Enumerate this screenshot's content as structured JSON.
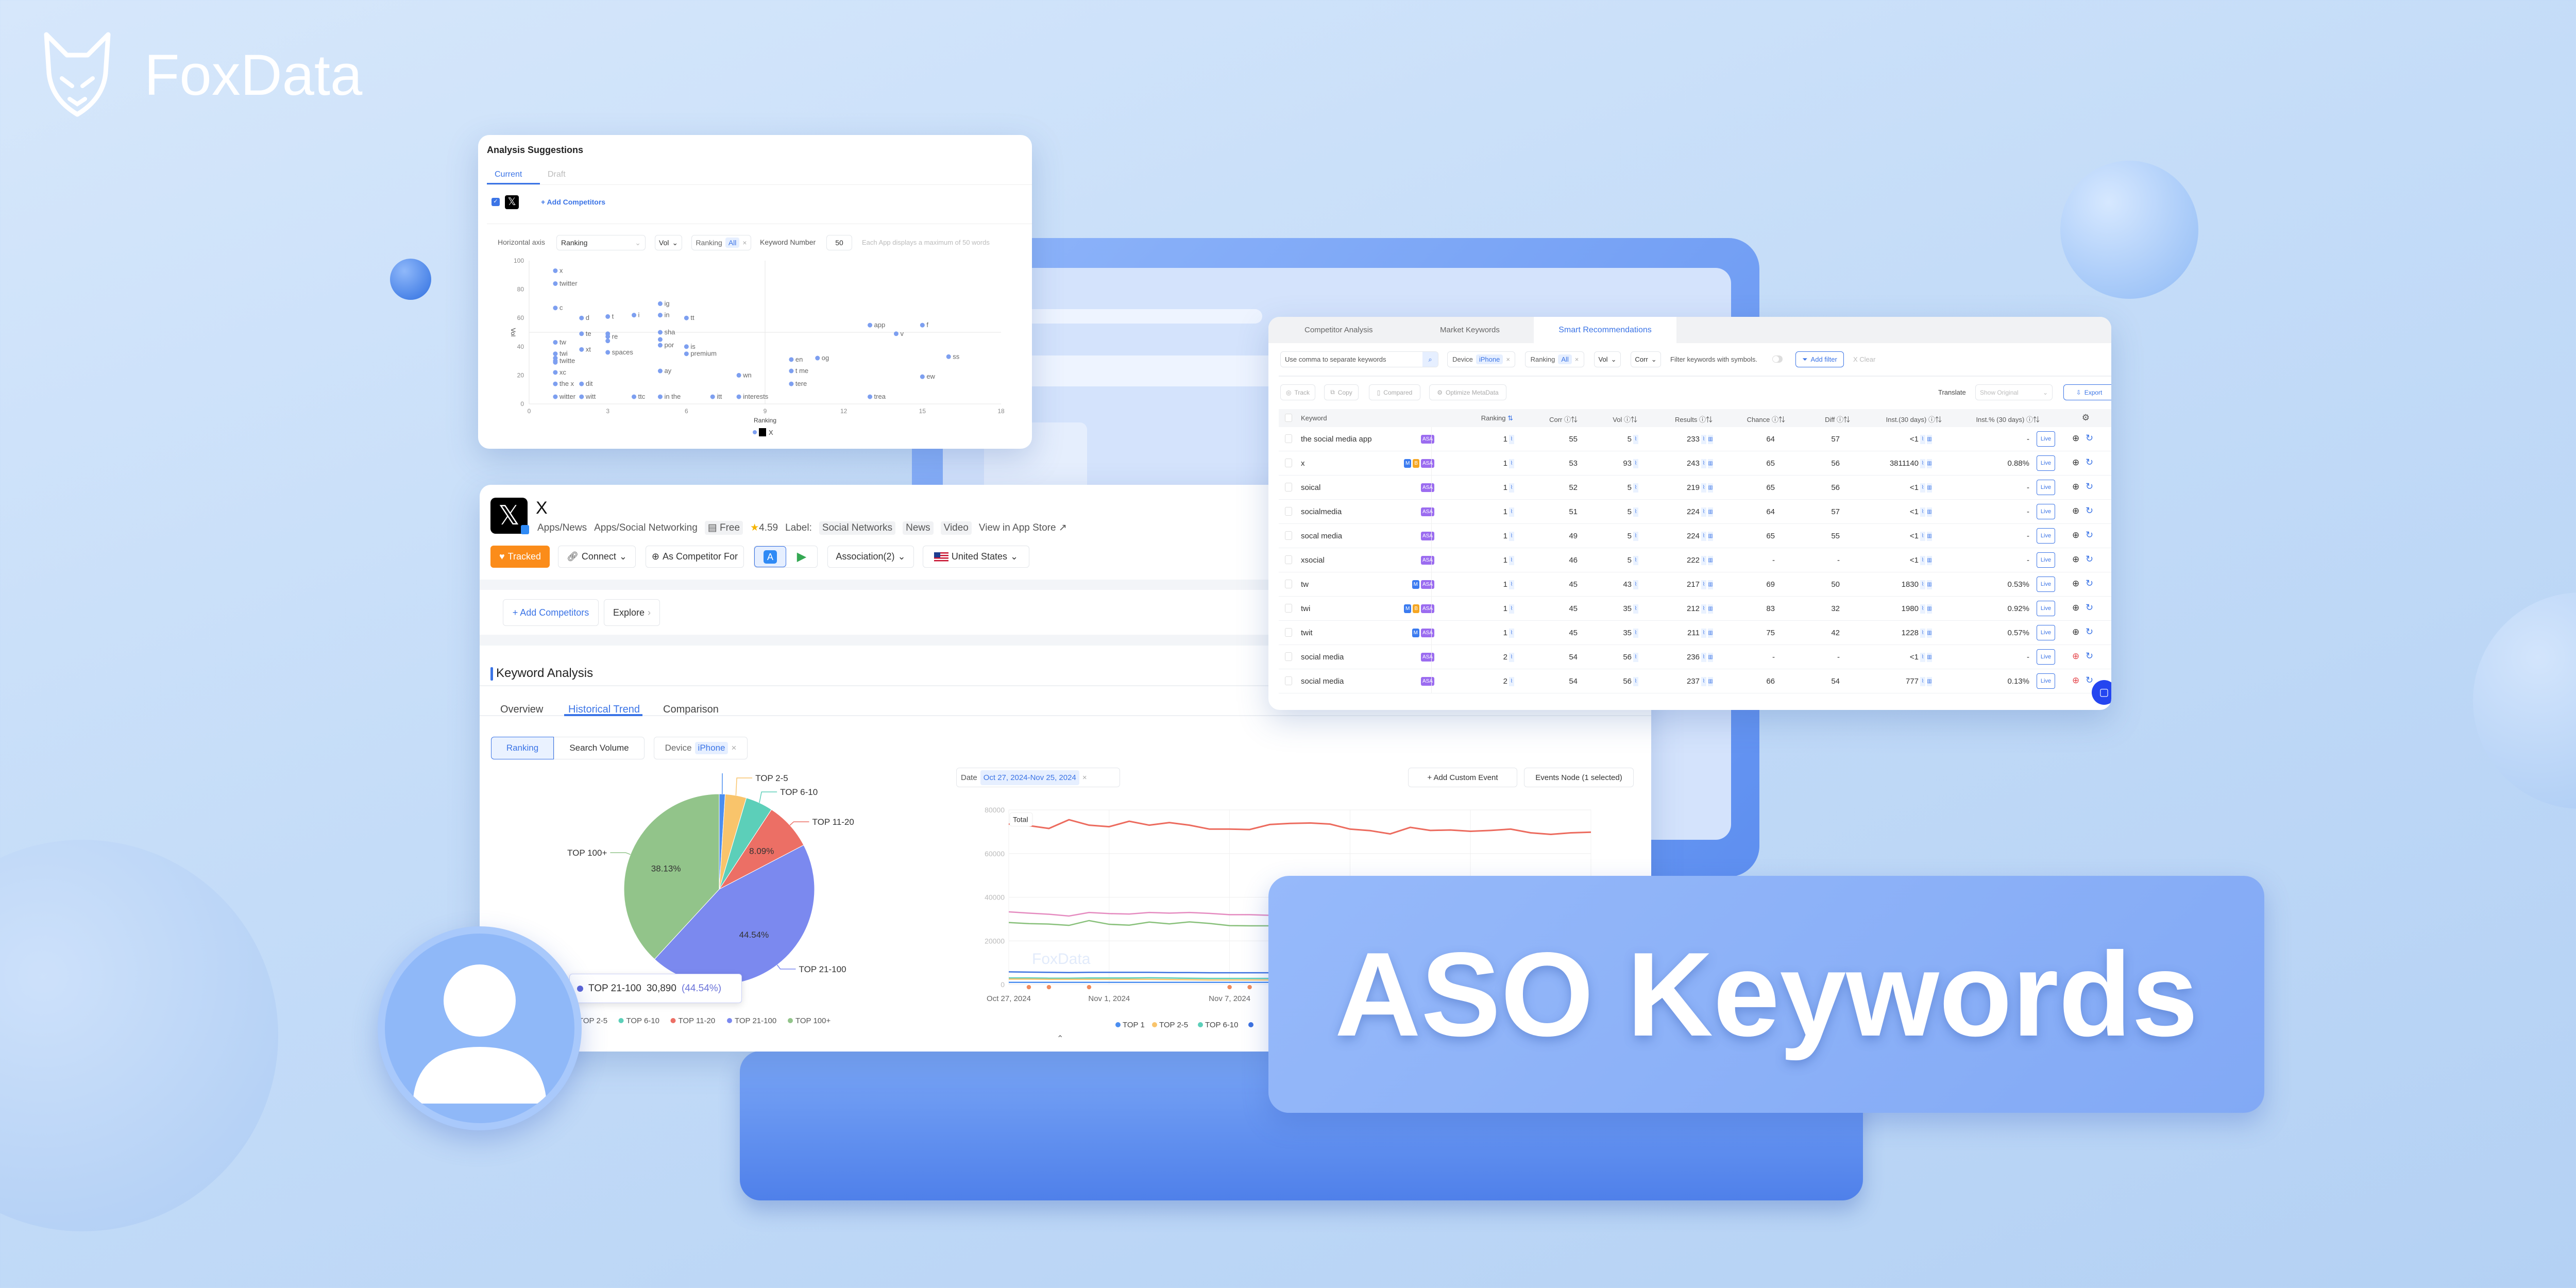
{
  "brand": {
    "name": "FoxData"
  },
  "banner": {
    "title": "ASO Keywords"
  },
  "colors": {
    "accent": "#3b74e6",
    "tracked": "#fb8c1a",
    "asa": "#9b6cf0",
    "badge_m": "#3b7bf0",
    "badge_b": "#f5a623",
    "banner": "#8fb4f8"
  },
  "analysis": {
    "title": "Analysis Suggestions",
    "tabs": [
      "Current",
      "Draft"
    ],
    "add_competitors": "+ Add Competitors",
    "controls": {
      "horizontal_axis_label": "Horizontal axis",
      "horizontal_axis_value": "Ranking",
      "vol": "Vol",
      "ranking_label": "Ranking",
      "ranking_value": "All",
      "keyword_number_label": "Keyword Number",
      "keyword_number_value": "50",
      "note": "Each App displays a maximum of 50 words"
    }
  },
  "app": {
    "icon": "x-app-icon",
    "name": "X",
    "category1": "Apps/News",
    "category2": "Apps/Social Networking",
    "price": "Free",
    "rating": "4.59",
    "label_prefix": "Label:",
    "labels": [
      "Social Networks",
      "News",
      "Video"
    ],
    "view_store": "View in App Store",
    "buttons": {
      "tracked": "Tracked",
      "connect": "Connect",
      "as_competitor": "As Competitor For",
      "association": "Association(2)",
      "country": "United States"
    },
    "add_competitors": "+ Add Competitors",
    "explore": "Explore",
    "section_title": "Keyword Analysis",
    "tabs": [
      "Overview",
      "Historical Trend",
      "Comparison"
    ],
    "active_tab": "Historical Trend",
    "toggle": [
      "Ranking",
      "Search Volume"
    ],
    "device_label": "Device",
    "device_value": "iPhone",
    "date_label": "Date",
    "date_value": "Oct 27, 2024-Nov 25, 2024",
    "add_event": "+ Add Custom Event",
    "events_node": "Events Node (1 selected)",
    "tooltip": {
      "name": "TOP 21-100",
      "value": "30,890",
      "pct": "(44.54%)"
    }
  },
  "keywords": {
    "tabs": [
      "Competitor Analysis",
      "Market Keywords",
      "Smart Recommendations"
    ],
    "active_tab": "Smart Recommendations",
    "search_placeholder": "Use comma to separate keywords",
    "filters": {
      "device_label": "Device",
      "device_value": "iPhone",
      "ranking_label": "Ranking",
      "ranking_value": "All",
      "vol": "Vol",
      "corr": "Corr",
      "symbols": "Filter keywords with symbols.",
      "add_filter": "Add filter",
      "clear": "X Clear"
    },
    "actions": [
      "Track",
      "Copy",
      "Compared",
      "Optimize MetaData"
    ],
    "translate_label": "Translate",
    "translate_value": "Show Original",
    "export": "Export",
    "columns": [
      "Keyword",
      "Ranking",
      "Corr",
      "Vol",
      "Results",
      "Chance",
      "Diff",
      "Inst.(30 days)",
      "Inst.% (30 days)"
    ],
    "live_label": "Live",
    "rows": [
      {
        "kw": "the social media app",
        "badges": [
          "ASA"
        ],
        "ranking": "1",
        "corr": "55",
        "vol": "5",
        "results": "233",
        "chance": "64",
        "diff": "57",
        "inst": "<1",
        "inst_pct": "-",
        "target": "normal"
      },
      {
        "kw": "x",
        "badges": [
          "M",
          "B",
          "ASA"
        ],
        "ranking": "1",
        "corr": "53",
        "vol": "93",
        "results": "243",
        "chance": "65",
        "diff": "56",
        "inst": "3811140",
        "inst_pct": "0.88%",
        "target": "normal"
      },
      {
        "kw": "soical",
        "badges": [
          "ASA"
        ],
        "ranking": "1",
        "corr": "52",
        "vol": "5",
        "results": "219",
        "chance": "65",
        "diff": "56",
        "inst": "<1",
        "inst_pct": "-",
        "target": "normal"
      },
      {
        "kw": "socialmedia",
        "badges": [
          "ASA"
        ],
        "ranking": "1",
        "corr": "51",
        "vol": "5",
        "results": "224",
        "chance": "64",
        "diff": "57",
        "inst": "<1",
        "inst_pct": "-",
        "target": "normal"
      },
      {
        "kw": "socal media",
        "badges": [
          "ASA"
        ],
        "ranking": "1",
        "corr": "49",
        "vol": "5",
        "results": "224",
        "chance": "65",
        "diff": "55",
        "inst": "<1",
        "inst_pct": "-",
        "target": "normal"
      },
      {
        "kw": "xsocial",
        "badges": [
          "ASA"
        ],
        "ranking": "1",
        "corr": "46",
        "vol": "5",
        "results": "222",
        "chance": "-",
        "diff": "-",
        "inst": "<1",
        "inst_pct": "-",
        "target": "normal"
      },
      {
        "kw": "tw",
        "badges": [
          "M",
          "ASA"
        ],
        "ranking": "1",
        "corr": "45",
        "vol": "43",
        "results": "217",
        "chance": "69",
        "diff": "50",
        "inst": "1830",
        "inst_pct": "0.53%",
        "target": "normal"
      },
      {
        "kw": "twi",
        "badges": [
          "M",
          "B",
          "ASA"
        ],
        "ranking": "1",
        "corr": "45",
        "vol": "35",
        "results": "212",
        "chance": "83",
        "diff": "32",
        "inst": "1980",
        "inst_pct": "0.92%",
        "target": "normal"
      },
      {
        "kw": "twit",
        "badges": [
          "M",
          "ASA"
        ],
        "ranking": "1",
        "corr": "45",
        "vol": "35",
        "results": "211",
        "chance": "75",
        "diff": "42",
        "inst": "1228",
        "inst_pct": "0.57%",
        "target": "normal"
      },
      {
        "kw": "social  media",
        "badges": [
          "ASA"
        ],
        "ranking": "2",
        "corr": "54",
        "vol": "56",
        "results": "236",
        "chance": "-",
        "diff": "-",
        "inst": "<1",
        "inst_pct": "-",
        "target": "red"
      },
      {
        "kw": "social media",
        "badges": [
          "ASA"
        ],
        "ranking": "2",
        "corr": "54",
        "vol": "56",
        "results": "237",
        "chance": "66",
        "diff": "54",
        "inst": "777",
        "inst_pct": "0.13%",
        "target": "red"
      }
    ]
  },
  "chart_data": [
    {
      "type": "scatter",
      "xlabel": "Ranking",
      "ylabel": "Vol",
      "xlim": [
        0,
        18
      ],
      "ylim": [
        0,
        100
      ],
      "xticks": [
        0,
        3,
        6,
        9,
        12,
        15,
        18
      ],
      "yticks": [
        0,
        20,
        40,
        60,
        80,
        100
      ],
      "legend": [
        "X"
      ],
      "color": "#7d9ff0",
      "points": [
        {
          "x": 1,
          "y": 93,
          "label": "x"
        },
        {
          "x": 1,
          "y": 84,
          "label": "twitter"
        },
        {
          "x": 1,
          "y": 67,
          "label": "c"
        },
        {
          "x": 2,
          "y": 60,
          "label": "d"
        },
        {
          "x": 3,
          "y": 61,
          "label": "t"
        },
        {
          "x": 4,
          "y": 62,
          "label": "i"
        },
        {
          "x": 5,
          "y": 70,
          "label": "ig"
        },
        {
          "x": 5,
          "y": 62,
          "label": "in"
        },
        {
          "x": 6,
          "y": 60,
          "label": "tt"
        },
        {
          "x": 13,
          "y": 55,
          "label": "app"
        },
        {
          "x": 15,
          "y": 55,
          "label": "f"
        },
        {
          "x": 14,
          "y": 49,
          "label": "v"
        },
        {
          "x": 2,
          "y": 49,
          "label": "te"
        },
        {
          "x": 3,
          "y": 49,
          "label": ""
        },
        {
          "x": 3,
          "y": 47,
          "label": "re"
        },
        {
          "x": 3,
          "y": 44,
          "label": ""
        },
        {
          "x": 5,
          "y": 50,
          "label": "sha"
        },
        {
          "x": 5,
          "y": 45,
          "label": ""
        },
        {
          "x": 1,
          "y": 43,
          "label": "tw"
        },
        {
          "x": 2,
          "y": 38,
          "label": "xt"
        },
        {
          "x": 5,
          "y": 41,
          "label": "por"
        },
        {
          "x": 6,
          "y": 40,
          "label": "is"
        },
        {
          "x": 3,
          "y": 36,
          "label": "spaces"
        },
        {
          "x": 1,
          "y": 35,
          "label": "twi"
        },
        {
          "x": 6,
          "y": 35,
          "label": "premium"
        },
        {
          "x": 1,
          "y": 32,
          "label": ""
        },
        {
          "x": 1,
          "y": 30,
          "label": "twitte"
        },
        {
          "x": 1,
          "y": 29,
          "label": ""
        },
        {
          "x": 10,
          "y": 31,
          "label": "en"
        },
        {
          "x": 11,
          "y": 32,
          "label": "og"
        },
        {
          "x": 16,
          "y": 33,
          "label": "ss"
        },
        {
          "x": 1,
          "y": 22,
          "label": "xc"
        },
        {
          "x": 5,
          "y": 23,
          "label": "ay"
        },
        {
          "x": 8,
          "y": 20,
          "label": "wn"
        },
        {
          "x": 10,
          "y": 23,
          "label": "t me"
        },
        {
          "x": 15,
          "y": 19,
          "label": "ew"
        },
        {
          "x": 1,
          "y": 14,
          "label": "the x"
        },
        {
          "x": 2,
          "y": 14,
          "label": "dit"
        },
        {
          "x": 10,
          "y": 14,
          "label": "tere"
        },
        {
          "x": 1,
          "y": 5,
          "label": "witter"
        },
        {
          "x": 2,
          "y": 5,
          "label": "witt"
        },
        {
          "x": 4,
          "y": 5,
          "label": "ttc"
        },
        {
          "x": 5,
          "y": 5,
          "label": "in the"
        },
        {
          "x": 7,
          "y": 5,
          "label": "itt"
        },
        {
          "x": 8,
          "y": 5,
          "label": "interests"
        },
        {
          "x": 13,
          "y": 5,
          "label": "trea"
        }
      ]
    },
    {
      "type": "pie",
      "slices": [
        {
          "name": "TOP 1",
          "value": 1.0,
          "color": "#4b8ef0",
          "label": ""
        },
        {
          "name": "TOP 2-5",
          "value": 3.6,
          "color": "#f9c46b",
          "label": ""
        },
        {
          "name": "TOP 6-10",
          "value": 4.64,
          "color": "#5ccfb9",
          "label": ""
        },
        {
          "name": "TOP 11-20",
          "value": 8.09,
          "color": "#ec6f65",
          "label": "8.09%"
        },
        {
          "name": "TOP 21-100",
          "value": 44.54,
          "color": "#7b89ef",
          "label": "44.54%"
        },
        {
          "name": "TOP 100+",
          "value": 38.13,
          "color": "#92c48a",
          "label": "38.13%"
        }
      ],
      "legend": [
        "TOP 2-5",
        "TOP 6-10",
        "TOP 11-20",
        "TOP 21-100",
        "TOP 100+"
      ],
      "legend_partial": "P 1"
    },
    {
      "type": "line",
      "x_start": "Oct 27, 2024",
      "x_end": "Nov 25, 2024",
      "ylim": [
        0,
        80000
      ],
      "yticks": [
        0,
        20000,
        40000,
        60000,
        80000
      ],
      "xticks": [
        {
          "day": 0,
          "label": "Oct 27, 2024"
        },
        {
          "day": 5,
          "label": "Nov 1, 2024"
        },
        {
          "day": 11,
          "label": "Nov 7, 2024"
        }
      ],
      "event_days": [
        1,
        2,
        4,
        11,
        12
      ],
      "legend": [
        {
          "name": "TOP 1",
          "color": "#4b8ef0"
        },
        {
          "name": "TOP 2-5",
          "color": "#f9c46b"
        },
        {
          "name": "TOP 6-10",
          "color": "#5ccfb9"
        }
      ],
      "watermark": "FoxData",
      "series": [
        {
          "name": "Total",
          "color": "#ec6b5e",
          "values": [
            73500,
            72800,
            71500,
            75500,
            73000,
            72300,
            74800,
            73000,
            74200,
            73000,
            71200,
            71200,
            71000,
            73300,
            73800,
            74000,
            73500,
            71200,
            70500,
            69000,
            72000,
            70600,
            70800,
            70200,
            70600,
            71200,
            69500,
            68800,
            69500,
            69800
          ]
        },
        {
          "color": "#e58bc0",
          "values": [
            33300,
            32700,
            32200,
            31400,
            33000,
            32500,
            32300,
            33000,
            32700,
            33000,
            32600,
            32000,
            32000,
            31700,
            32200,
            32500,
            32600,
            32400,
            31600,
            31300,
            31000,
            31800,
            31400,
            31500,
            31200,
            31300,
            31500,
            31000,
            30800,
            31000
          ]
        },
        {
          "color": "#88c07a",
          "values": [
            28400,
            27900,
            27700,
            27100,
            29300,
            27600,
            27200,
            28600,
            27800,
            28700,
            28000,
            27000,
            26900,
            26900,
            27300,
            27600,
            27700,
            27500,
            26800,
            26500,
            26300,
            27000,
            26700,
            26800,
            26500,
            26600,
            26800,
            26300,
            26100,
            26300
          ]
        },
        {
          "color": "#3d72e0",
          "values": [
            5800,
            5700,
            5600,
            5500,
            5600,
            5600,
            5600,
            5600,
            5500,
            5500,
            5400,
            5400,
            5400,
            5400,
            5400,
            5400,
            5400,
            5400,
            5300,
            5300,
            5300,
            5300,
            5300,
            5300,
            5300,
            5300,
            5300,
            5300,
            5300,
            5300
          ]
        },
        {
          "color": "#5ccfb9",
          "values": [
            3000,
            3000,
            2900,
            2900,
            3000,
            3000,
            3000,
            3100,
            3000,
            2900,
            2800,
            2800,
            2800,
            2800,
            2800,
            2800,
            2800,
            2800,
            2800,
            2800,
            2800,
            2800,
            2800,
            2800,
            2800,
            2800,
            2800,
            2800,
            2800,
            2800
          ]
        },
        {
          "color": "#f9c46b",
          "values": [
            2500,
            2500,
            2400,
            2400,
            2400,
            2400,
            2400,
            2400,
            2300,
            2200,
            2100,
            2100,
            2100,
            2100,
            2100,
            2100,
            2100,
            2100,
            2100,
            2100,
            2100,
            2100,
            2100,
            2100,
            2100,
            2100,
            2100,
            2100,
            2100,
            2100
          ]
        },
        {
          "color": "#4b8ef0",
          "values": [
            1000,
            1000,
            1000,
            1000,
            1000,
            1000,
            1000,
            1000,
            1000,
            1000,
            1000,
            1000,
            1000,
            1000,
            1000,
            1000,
            1000,
            1000,
            1000,
            1000,
            1000,
            1000,
            1000,
            1000,
            1000,
            1000,
            1000,
            1000,
            1000,
            1000
          ]
        }
      ]
    }
  ]
}
